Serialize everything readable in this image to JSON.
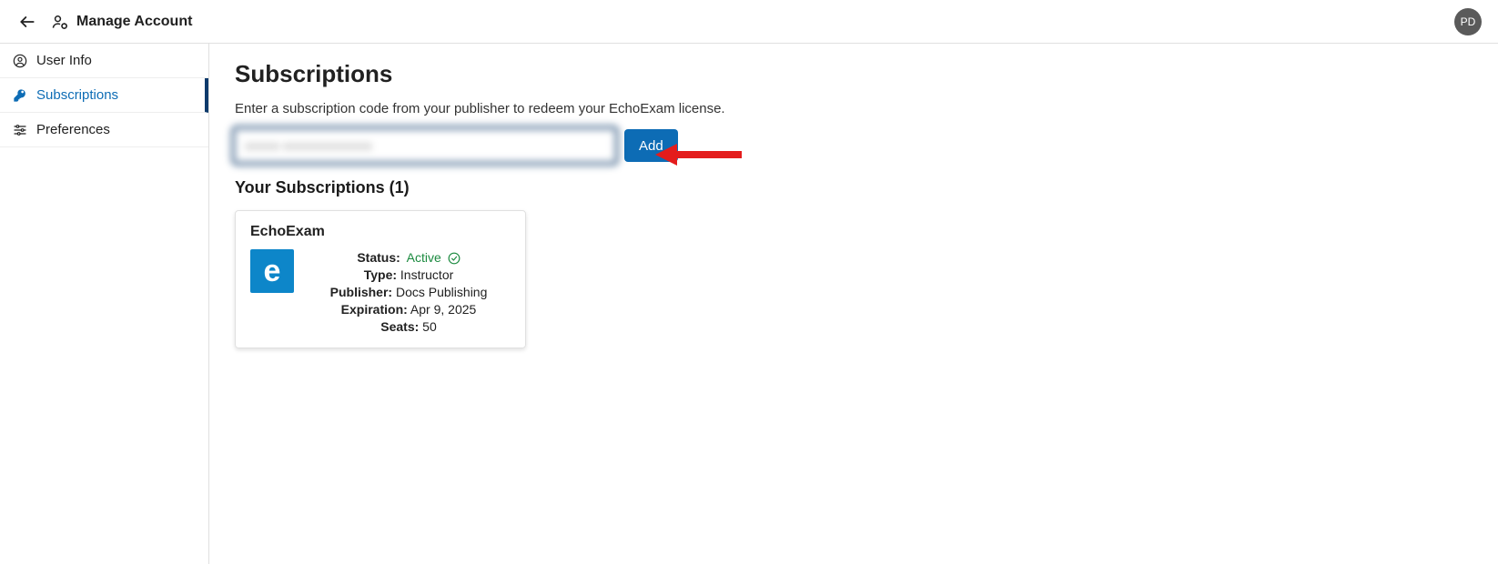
{
  "header": {
    "title": "Manage Account",
    "avatar_initials": "PD"
  },
  "sidebar": {
    "items": [
      {
        "label": "User Info",
        "active": false
      },
      {
        "label": "Subscriptions",
        "active": true
      },
      {
        "label": "Preferences",
        "active": false
      }
    ]
  },
  "main": {
    "title": "Subscriptions",
    "instruction": "Enter a subscription code from your publisher to redeem your EchoExam license.",
    "code_input_value": "xxxxx-xxxxxxxxxxxxx",
    "add_button_label": "Add",
    "your_subs_label": "Your Subscriptions (1)"
  },
  "subscription": {
    "product_name": "EchoExam",
    "logo_letter": "e",
    "status_label": "Status:",
    "status_value": "Active",
    "type_label": "Type:",
    "type_value": "Instructor",
    "publisher_label": "Publisher:",
    "publisher_value": "Docs Publishing",
    "expiration_label": "Expiration:",
    "expiration_value": "Apr 9, 2025",
    "seats_label": "Seats:",
    "seats_value": "50"
  }
}
